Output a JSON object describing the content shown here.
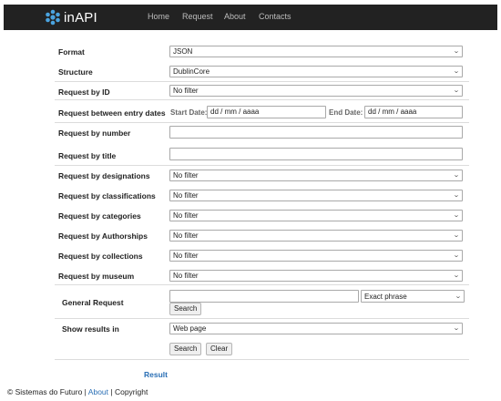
{
  "nav": {
    "brand": "inAPI",
    "items": [
      "Home",
      "Request",
      "About",
      "Contacts"
    ]
  },
  "form": {
    "format": {
      "label": "Format",
      "value": "JSON"
    },
    "structure": {
      "label": "Structure",
      "value": "DublinCore"
    },
    "by_id": {
      "label": "Request by ID",
      "value": "No filter"
    },
    "dates": {
      "label": "Request between entry dates",
      "start_label": "Start Date:",
      "start_value": "dd / mm / aaaa",
      "end_label": "End Date:",
      "end_value": "dd / mm / aaaa"
    },
    "by_number": {
      "label": "Request by number",
      "value": ""
    },
    "by_title": {
      "label": "Request by title",
      "value": ""
    },
    "by_designations": {
      "label": "Request by designations",
      "value": "No filter"
    },
    "by_classifications": {
      "label": "Request by classifications",
      "value": "No filter"
    },
    "by_categories": {
      "label": "Request by categories",
      "value": "No filter"
    },
    "by_authorships": {
      "label": "Request by Authorships",
      "value": "No filter"
    },
    "by_collections": {
      "label": "Request by collections",
      "value": "No filter"
    },
    "by_museum": {
      "label": "Request by museum",
      "value": "No filter"
    },
    "general": {
      "label": "General Request",
      "value": "",
      "match_value": "Exact phrase",
      "search_label": "Search"
    },
    "show_results": {
      "label": "Show results in",
      "value": "Web page"
    },
    "search_label": "Search",
    "clear_label": "Clear"
  },
  "result_label": "Result",
  "footer": {
    "prefix": "© Sistemas do Futuro | ",
    "about": "About",
    "suffix": " | Copyright"
  },
  "colors": {
    "navbar": "#222222",
    "link": "#2a6fb5",
    "logo": "#4aa3df"
  }
}
